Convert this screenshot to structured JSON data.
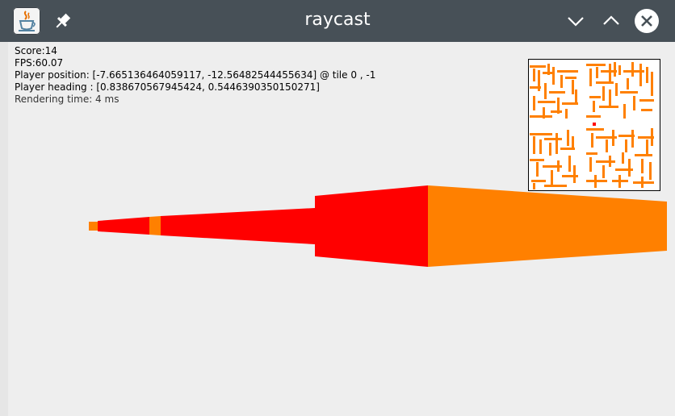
{
  "window": {
    "title": "raycast",
    "app_icon": "java-cup-icon",
    "pin_icon": "pin-icon",
    "buttons": {
      "minimize": "chevron-down-icon",
      "maximize": "chevron-up-icon",
      "close": "close-icon"
    }
  },
  "hud": {
    "score": "Score:14",
    "fps": "FPS:60.07",
    "position": "Player position: [-7.665136464059117, -12.56482544455634] @ tile 0 , -1",
    "heading": "Player heading : [0.838670567945424, 0.5446390350150271]",
    "render_time": "Rendering time: 4 ms"
  },
  "colors": {
    "titlebar": "#475057",
    "background": "#eeeeee",
    "wall_red": "#ff0000",
    "wall_orange": "#ff8000",
    "player_dot": "#ff0000"
  }
}
